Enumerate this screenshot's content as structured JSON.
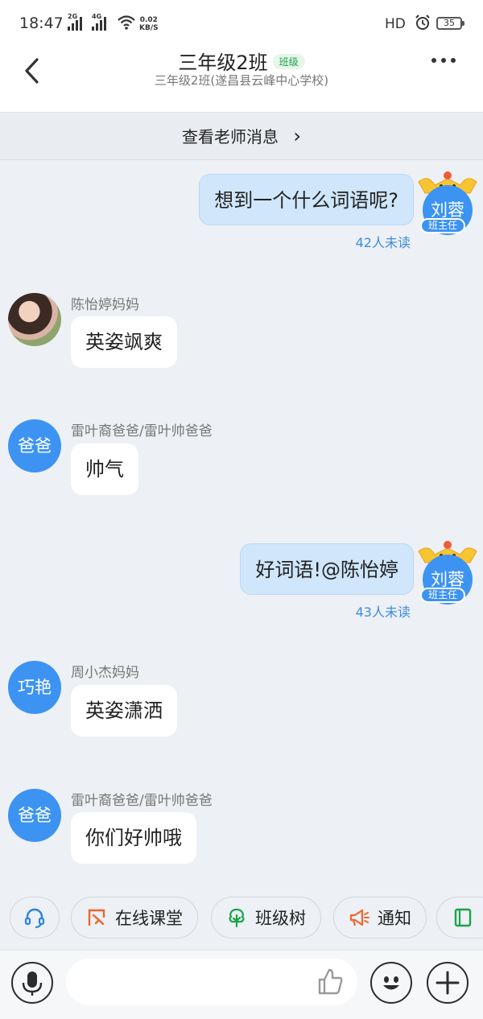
{
  "status_bar": {
    "time": "18:47",
    "signal_1_label": "2G",
    "signal_2_label": "4G",
    "net_speed_value": "0.02",
    "net_speed_unit": "KB/S",
    "hd_label": "HD",
    "battery": "35"
  },
  "header": {
    "title": "三年级2班",
    "badge": "班级",
    "subtitle": "三年级2班(遂昌县云峰中心学校)",
    "back_icon": "chevron-left-icon",
    "more_icon": "more-dots-icon"
  },
  "teacher_bar": {
    "label": "查看老师消息",
    "chevron": "›"
  },
  "messages": [
    {
      "side": "out",
      "avatar_text": "刘蓉",
      "role": "班主任",
      "text": "想到一个什么词语呢?",
      "unread": "42人未读"
    },
    {
      "side": "in",
      "sender": "陈怡婷妈妈",
      "avatar_type": "photo",
      "text": "英姿飒爽"
    },
    {
      "side": "in",
      "sender": "雷叶裔爸爸/雷叶帅爸爸",
      "avatar_text": "爸爸",
      "text": "帅气"
    },
    {
      "side": "out",
      "avatar_text": "刘蓉",
      "role": "班主任",
      "text": "好词语!@陈怡婷",
      "unread": "43人未读"
    },
    {
      "side": "in",
      "sender": "周小杰妈妈",
      "avatar_text": "巧艳",
      "text": "英姿潇洒"
    },
    {
      "side": "in",
      "sender": "雷叶裔爸爸/雷叶帅爸爸",
      "avatar_text": "爸爸",
      "text": "你们好帅哦"
    }
  ],
  "shortcuts": [
    {
      "icon": "headset-icon",
      "label": ""
    },
    {
      "icon": "online-class-icon",
      "label": "在线课堂"
    },
    {
      "icon": "tree-icon",
      "label": "班级树"
    },
    {
      "icon": "megaphone-icon",
      "label": "通知"
    },
    {
      "icon": "notebook-icon",
      "label": ""
    }
  ],
  "input_bar": {
    "voice_icon": "microphone-icon",
    "like_icon": "thumbs-up-icon",
    "emoji_icon": "emoji-icon",
    "plus_icon": "plus-icon"
  },
  "colors": {
    "accent": "#3d93f1",
    "bubble_out": "#cfe6fb",
    "background": "#edf0f4",
    "unread_text": "#3d8de0"
  }
}
